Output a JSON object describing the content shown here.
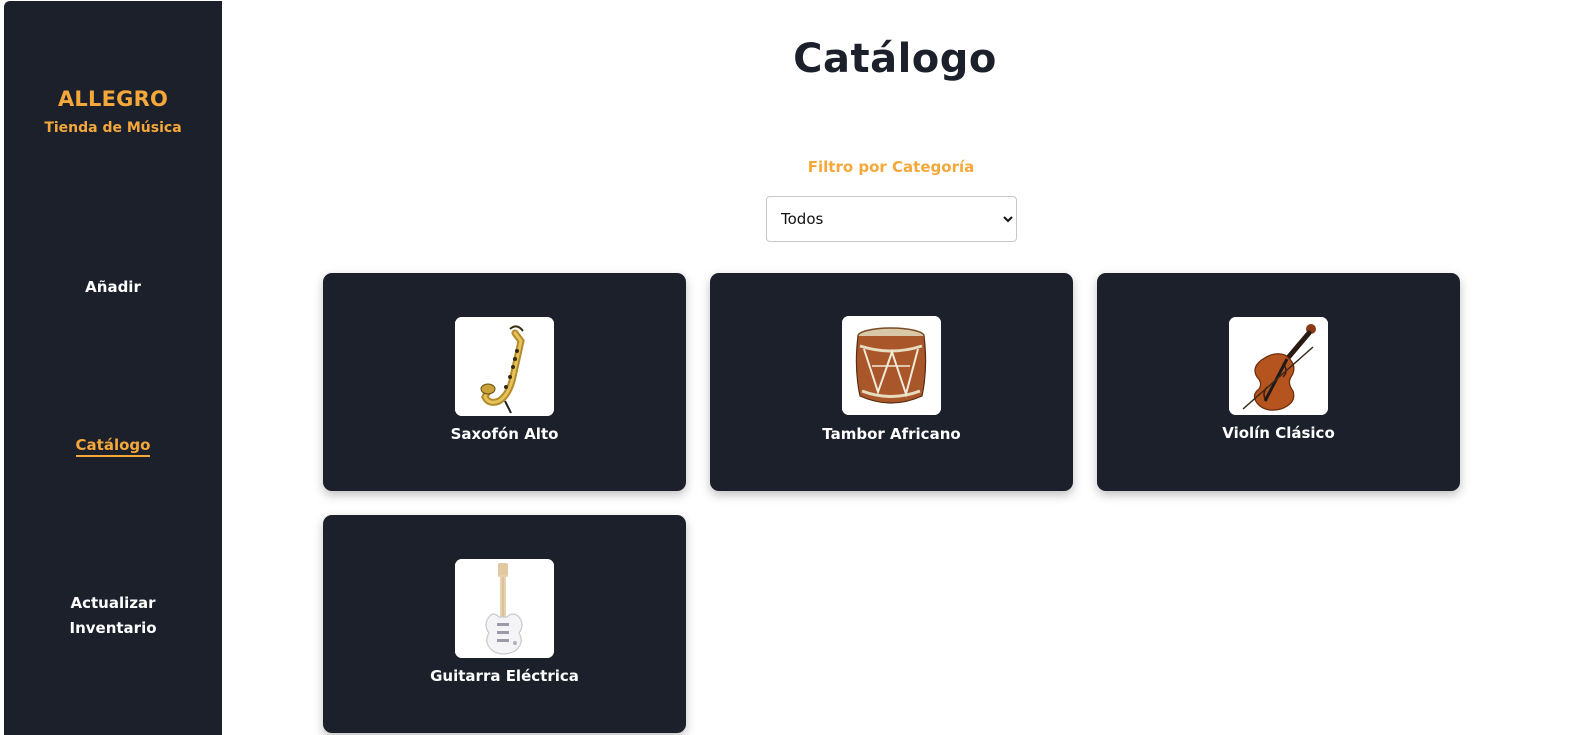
{
  "sidebar": {
    "brand_title": "ALLEGRO",
    "brand_subtitle": "Tienda de Música",
    "nav": [
      {
        "label": "Añadir",
        "active": false
      },
      {
        "label": "Catálogo",
        "active": true
      },
      {
        "label": "Actualizar Inventario",
        "active": false
      }
    ]
  },
  "main": {
    "title": "Catálogo",
    "filter": {
      "label": "Filtro por Categoría",
      "selected": "Todos",
      "options": [
        "Todos"
      ]
    },
    "products": [
      {
        "name": "Saxofón Alto",
        "icon": "saxophone-icon"
      },
      {
        "name": "Tambor Africano",
        "icon": "drum-icon"
      },
      {
        "name": "Violín Clásico",
        "icon": "violin-icon"
      },
      {
        "name": "Guitarra Eléctrica",
        "icon": "electric-guitar-icon"
      }
    ]
  },
  "colors": {
    "sidebar_bg": "#1b202b",
    "accent": "#f5a83a",
    "card_bg": "#1b202b",
    "title_text": "#1b202b"
  }
}
